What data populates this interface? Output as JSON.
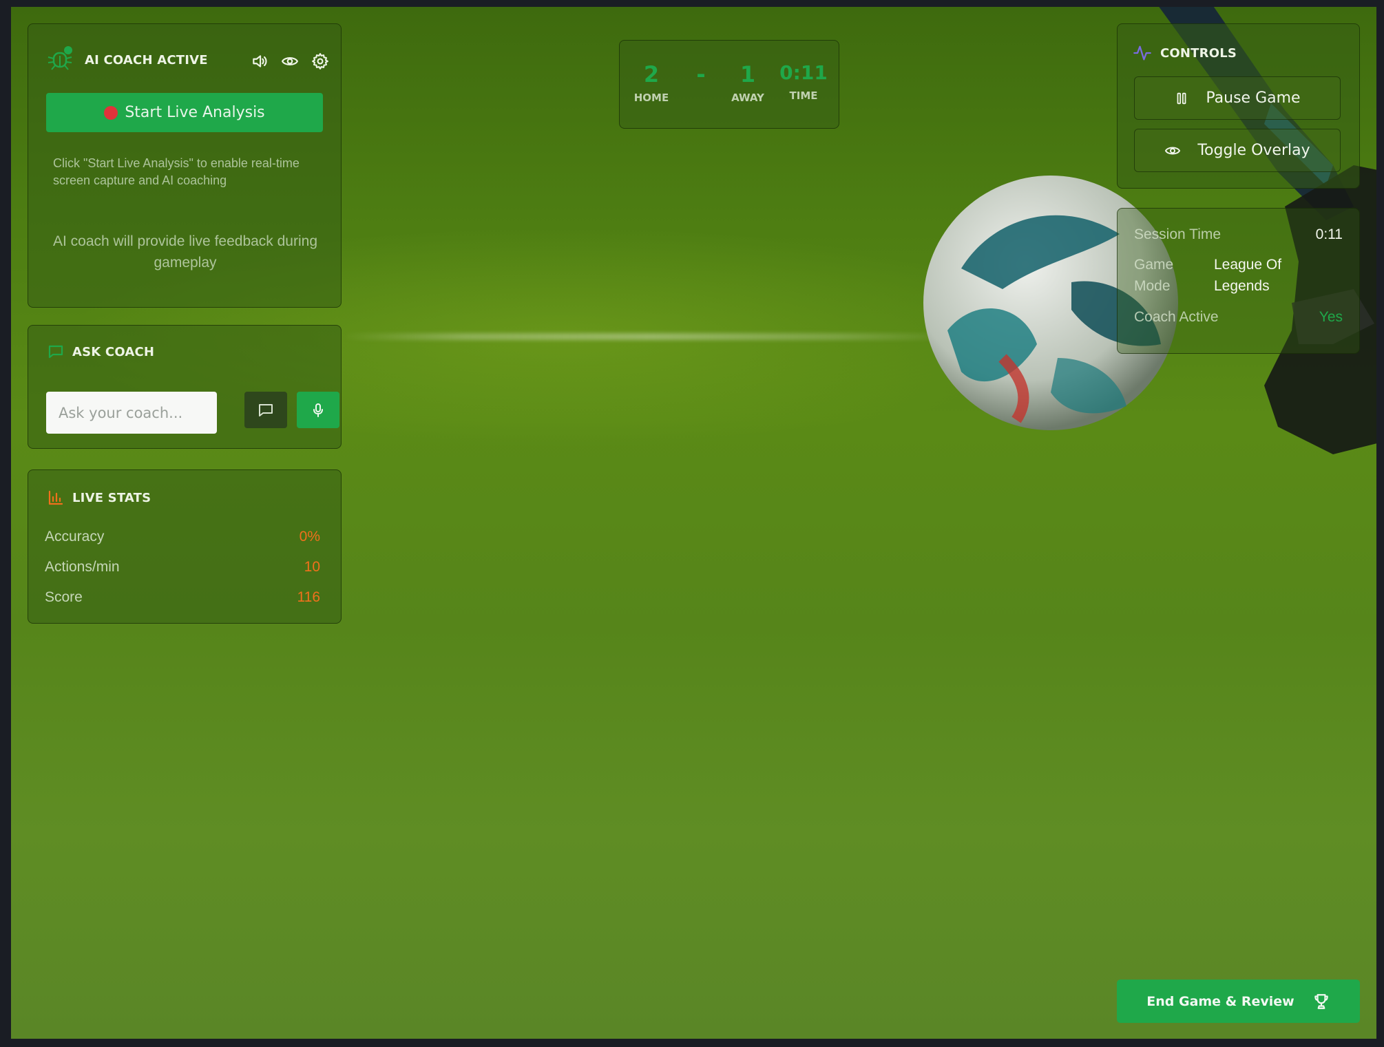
{
  "coach_panel": {
    "title": "AI COACH ACTIVE",
    "start_button": "Start Live Analysis",
    "hint": "Click \"Start Live Analysis\" to enable real-time screen capture and AI coaching",
    "feedback": "AI coach will provide live feedback during gameplay",
    "icons": [
      "bug-icon",
      "volume-icon",
      "eye-icon",
      "gear-icon"
    ]
  },
  "ask_coach": {
    "title": "ASK COACH",
    "input_placeholder": "Ask your coach...",
    "icons": [
      "message-icon",
      "chat-send-icon",
      "microphone-icon"
    ]
  },
  "live_stats": {
    "title": "LIVE STATS",
    "rows": [
      {
        "label": "Accuracy",
        "value": "0%"
      },
      {
        "label": "Actions/min",
        "value": "10"
      },
      {
        "label": "Score",
        "value": "116"
      }
    ]
  },
  "scoreboard": {
    "home_score": "2",
    "home_label": "HOME",
    "separator": "-",
    "away_score": "1",
    "away_label": "AWAY",
    "time_value": "0:11",
    "time_label": "TIME"
  },
  "controls": {
    "title": "CONTROLS",
    "pause_button": "Pause Game",
    "toggle_button": "Toggle Overlay"
  },
  "session": {
    "session_time_label": "Session Time",
    "session_time_value": "0:11",
    "game_mode_label_1": "Game",
    "game_mode_label_2": "Mode",
    "game_mode_value_1": "League Of",
    "game_mode_value_2": "Legends",
    "coach_active_label": "Coach Active",
    "coach_active_value": "Yes"
  },
  "end_game": {
    "label": "End Game & Review"
  },
  "colors": {
    "accent_green": "#1fa84a",
    "stat_orange": "#f0701c",
    "record_red": "#e0333a"
  }
}
